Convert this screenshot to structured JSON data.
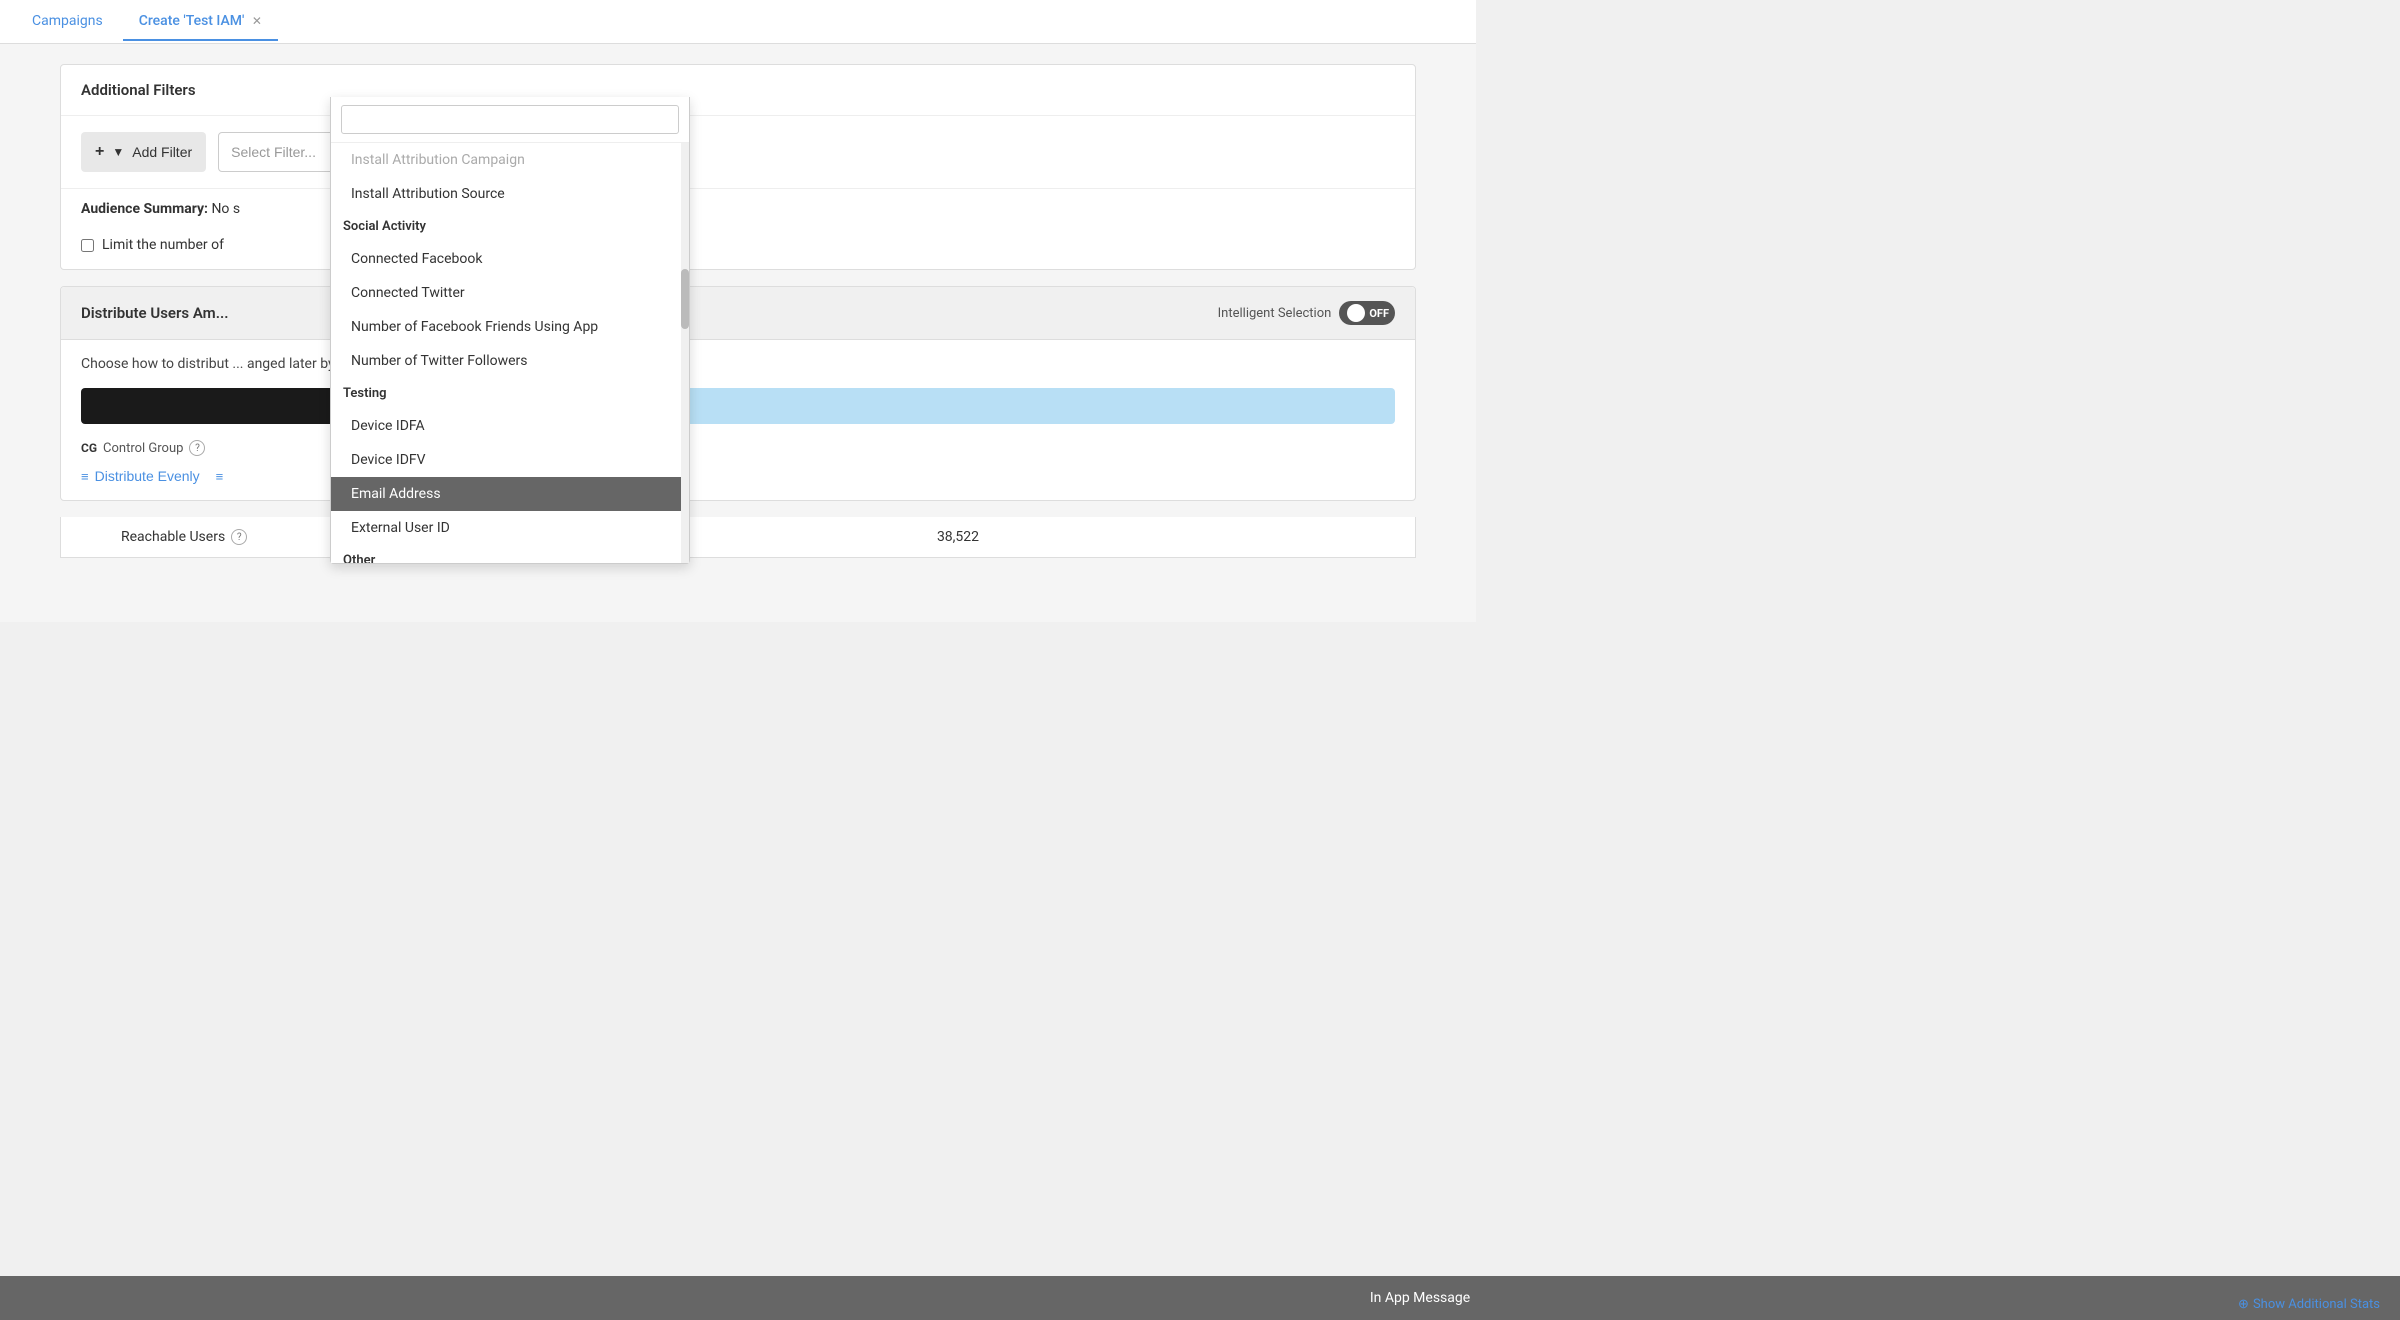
{
  "tabs": [
    {
      "id": "campaigns",
      "label": "Campaigns",
      "active": false,
      "closable": false
    },
    {
      "id": "create-test-iam",
      "label": "Create 'Test IAM'",
      "active": true,
      "closable": true
    }
  ],
  "additional_filters": {
    "section_title": "Additional Filters",
    "add_filter_label": "Add Filter",
    "select_placeholder": "Select Filter...",
    "audience_summary_label": "Audience Summary:",
    "audience_summary_value": "No s",
    "limit_label": "Limit the number of"
  },
  "dropdown": {
    "search_placeholder": "",
    "items": [
      {
        "type": "item",
        "label": "Install Attribution Campaign",
        "faded": true
      },
      {
        "type": "item",
        "label": "Install Attribution Source"
      },
      {
        "type": "group",
        "label": "Social Activity"
      },
      {
        "type": "item",
        "label": "Connected Facebook"
      },
      {
        "type": "item",
        "label": "Connected Twitter"
      },
      {
        "type": "item",
        "label": "Number of Facebook Friends Using App"
      },
      {
        "type": "item",
        "label": "Number of Twitter Followers"
      },
      {
        "type": "group",
        "label": "Testing"
      },
      {
        "type": "item",
        "label": "Device IDFA"
      },
      {
        "type": "item",
        "label": "Device IDFV"
      },
      {
        "type": "item",
        "label": "Email Address",
        "highlighted": true
      },
      {
        "type": "item",
        "label": "External User ID"
      },
      {
        "type": "group",
        "label": "Other"
      }
    ]
  },
  "distribute": {
    "section_title": "Distribute Users Am",
    "intelligent_selection_label": "Intelligent Selection",
    "toggle_label": "OFF",
    "description": "Choose how to distribut",
    "description_suffix": "anged later by editing the Campaign.",
    "control_group_label": "Control Group",
    "cg_badge": "CG",
    "distribute_evenly_label": "Distribute Evenly"
  },
  "stats": {
    "bar_label": "In App Message",
    "reachable_label": "Reachable Users",
    "reachable_value": "38,522",
    "show_additional": "Show Additional Stats"
  }
}
